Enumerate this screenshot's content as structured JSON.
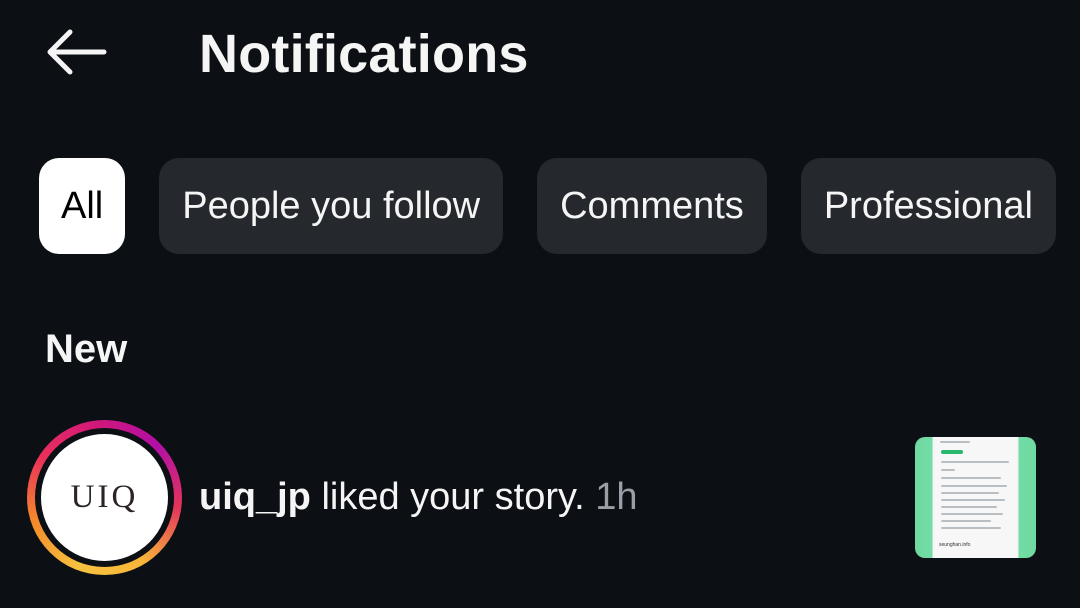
{
  "header": {
    "back_icon": "arrow-left-icon",
    "title": "Notifications"
  },
  "filters": [
    {
      "label": "All",
      "active": true
    },
    {
      "label": "People you follow",
      "active": false
    },
    {
      "label": "Comments",
      "active": false
    },
    {
      "label": "Professional",
      "active": false
    }
  ],
  "sections": {
    "new_label": "New"
  },
  "notifications": [
    {
      "avatar_text": "UIQ",
      "username": "uiq_jp",
      "action": " liked your story.",
      "time": "1h",
      "has_story_ring": true,
      "thumbnail_caption": "seunghan.info"
    }
  ],
  "colors": {
    "background": "#0c0f14",
    "chip_background": "#25282d",
    "chip_active_background": "#ffffff",
    "muted_text": "#9a9ea6"
  }
}
